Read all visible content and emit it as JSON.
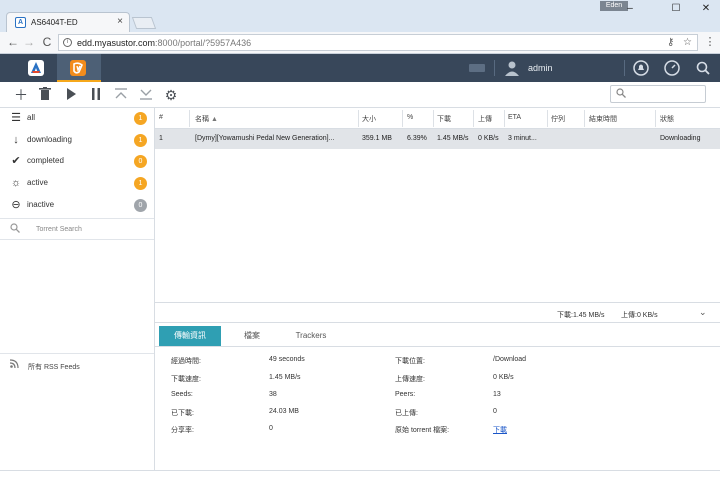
{
  "browser": {
    "tab_title": "AS6404T-ED",
    "tab_close": "×",
    "favicon": "A",
    "user_chip": "Eden",
    "url_host": "edd.myasustor.com",
    "url_rest": ":8000/portal/?5957A436",
    "info_icon": "i",
    "window_controls": [
      "–",
      "☐",
      "✕"
    ],
    "nav": {
      "back": "←",
      "forward": "→",
      "reload": "C"
    }
  },
  "app": {
    "username": "admin"
  },
  "sidebar": {
    "items": [
      {
        "label": "all",
        "count": "1",
        "icon": "list-icon",
        "glyph": "☰",
        "badge_color": "#f5a623"
      },
      {
        "label": "downloading",
        "count": "1",
        "icon": "arrow-down-icon",
        "glyph": "↓",
        "badge_color": "#f5a623"
      },
      {
        "label": "completed",
        "count": "0",
        "icon": "check-icon",
        "glyph": "✔",
        "badge_color": "#f5a623"
      },
      {
        "label": "active",
        "count": "1",
        "icon": "sun-icon",
        "glyph": "☼",
        "badge_color": "#f5a623"
      },
      {
        "label": "inactive",
        "count": "0",
        "icon": "minus-circle-icon",
        "glyph": "⊖",
        "badge_color": "#a0a5ab"
      }
    ],
    "search_placeholder": "Torrent Search",
    "rss_label": "所有 RSS Feeds"
  },
  "table": {
    "columns": [
      "#",
      "名稱",
      "大小",
      "%",
      "下載",
      "上傳",
      "ETA",
      "佇列",
      "結束時間",
      "狀態"
    ],
    "sort_arrow": "▲",
    "rows": [
      {
        "index": "1",
        "name": "[Dymy][Yowamushi Pedal New Generation]...",
        "size": "359.1 MB",
        "percent": "6.39%",
        "download": "1.45 MB/s",
        "upload": "0 KB/s",
        "eta": "3 minut...",
        "queue": "",
        "end_time": "",
        "status": "Downloading"
      }
    ]
  },
  "status_bar": {
    "download": "下載:1.45 MB/s",
    "upload": "上傳:0 KB/s",
    "chevron": "⌄"
  },
  "detail": {
    "tabs": [
      "傳輸資訊",
      "檔案",
      "Trackers"
    ],
    "left": [
      {
        "label": "經過時間:",
        "value": "49 seconds"
      },
      {
        "label": "下載速度:",
        "value": "1.45 MB/s"
      },
      {
        "label": "Seeds:",
        "value": "38"
      },
      {
        "label": "已下載:",
        "value": "24.03 MB"
      },
      {
        "label": "分享率:",
        "value": "0"
      }
    ],
    "right": [
      {
        "label": "下載位置:",
        "value": "/Download"
      },
      {
        "label": "上傳速度:",
        "value": "0 KB/s"
      },
      {
        "label": "Peers:",
        "value": "13"
      },
      {
        "label": "已上傳:",
        "value": "0"
      },
      {
        "label": "原始 torrent 檔案:",
        "value": "下載"
      }
    ]
  }
}
